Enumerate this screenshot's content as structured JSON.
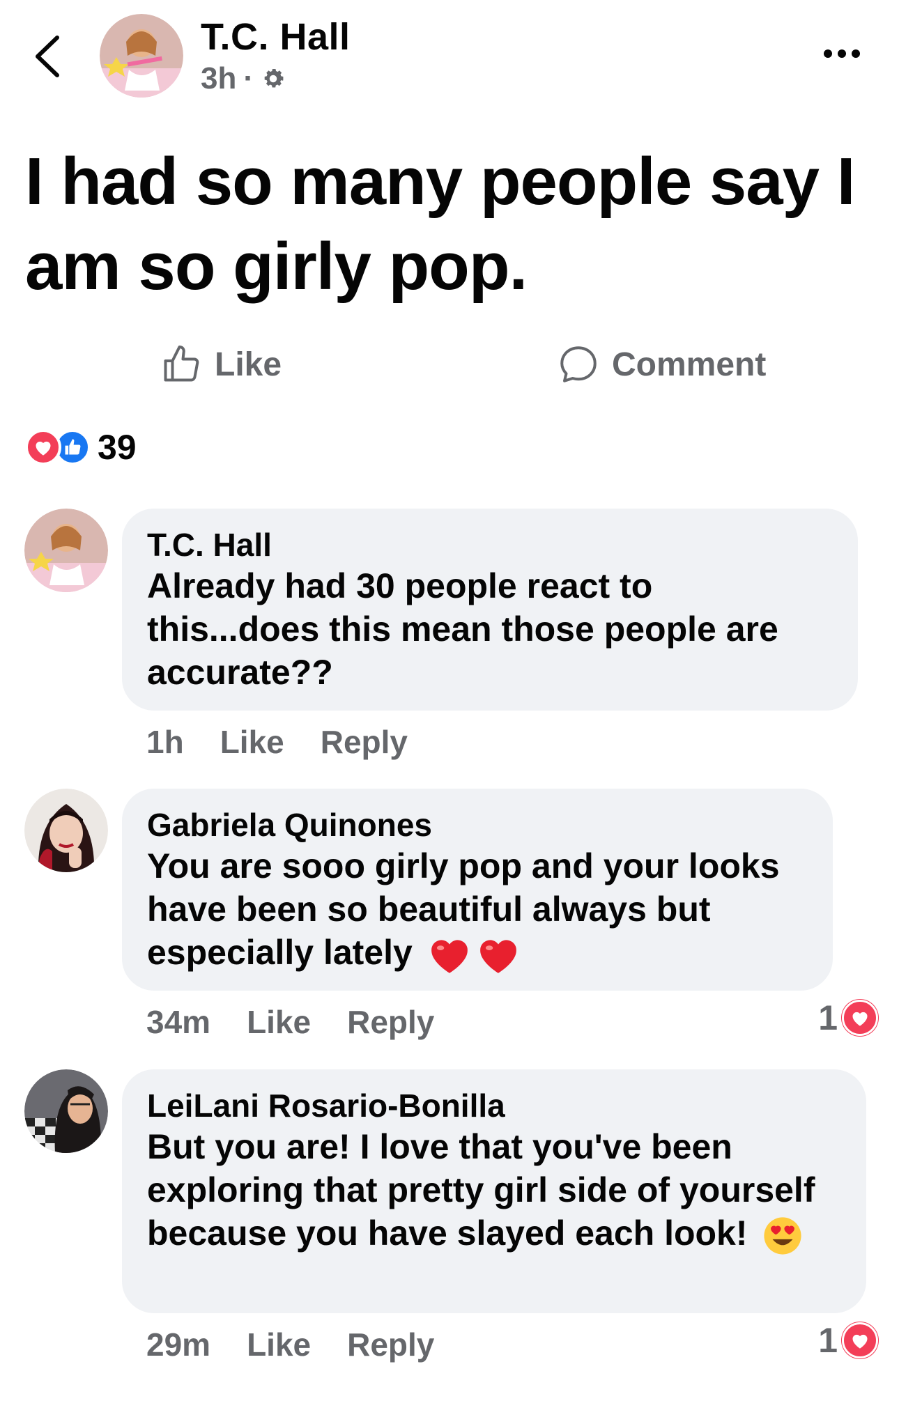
{
  "post": {
    "author": "T.C. Hall",
    "time": "3h",
    "separator": "·",
    "text": "I had so many people say I am so girly pop.",
    "like_label": "Like",
    "comment_label": "Comment",
    "reaction_count": "39",
    "reaction_icons": [
      "love-icon",
      "like-icon"
    ]
  },
  "comments": [
    {
      "author": "T.C. Hall",
      "text": "Already had 30 people react to this...does this mean those people are accurate??",
      "time": "1h",
      "like_label": "Like",
      "reply_label": "Reply"
    },
    {
      "author": "Gabriela Quinones",
      "text": "You are sooo girly pop and your looks have been so beautiful always but especially lately",
      "time": "34m",
      "like_label": "Like",
      "reply_label": "Reply",
      "reaction_count": "1"
    },
    {
      "author": "LeiLani Rosario-Bonilla",
      "text": "But you are! I love that you've been exploring that pretty girl side of yourself because you have slayed each look!",
      "time": "29m",
      "like_label": "Like",
      "reply_label": "Reply",
      "reaction_count": "1"
    }
  ],
  "colors": {
    "text": "#050505",
    "secondary": "#65676b",
    "bubble": "#f0f2f5",
    "love": "#f33e58",
    "like": "#1877f2"
  }
}
